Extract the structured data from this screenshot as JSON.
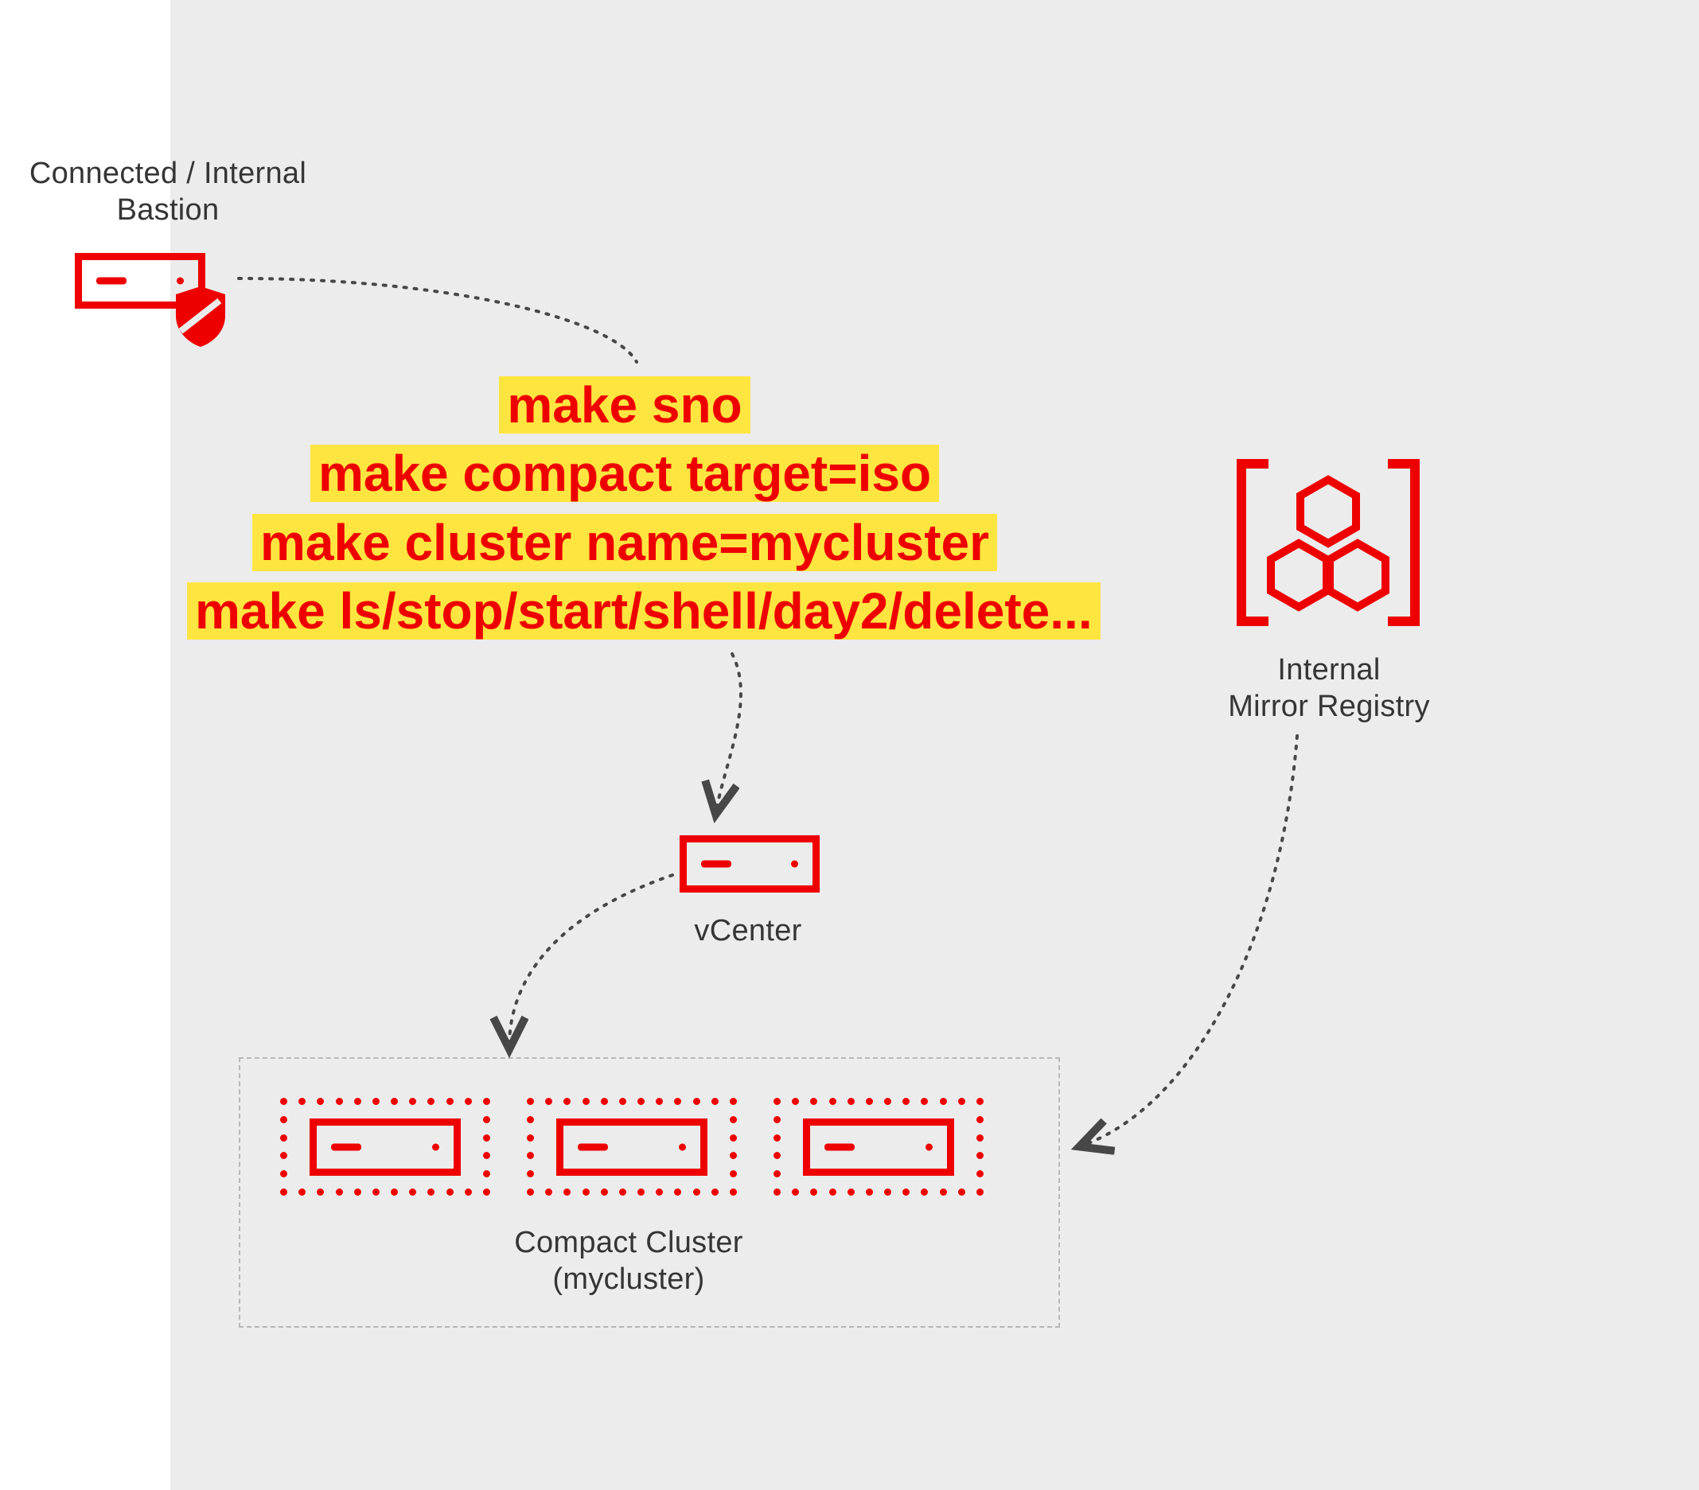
{
  "bastion": {
    "label_line1": "Connected / Internal",
    "label_line2": "Bastion"
  },
  "commands": {
    "line1": "make sno",
    "line2": "make compact target=iso",
    "line3": "make cluster name=mycluster",
    "line4": "make ls/stop/start/shell/day2/delete..."
  },
  "vcenter": {
    "label": "vCenter"
  },
  "cluster": {
    "label_line1": "Compact Cluster",
    "label_line2": "(mycluster)"
  },
  "registry": {
    "label_line1": "Internal",
    "label_line2": "Mirror Registry"
  },
  "colors": {
    "accent": "#ee0000",
    "highlight": "#ffe540",
    "bg": "#ececec",
    "text": "#353535"
  }
}
